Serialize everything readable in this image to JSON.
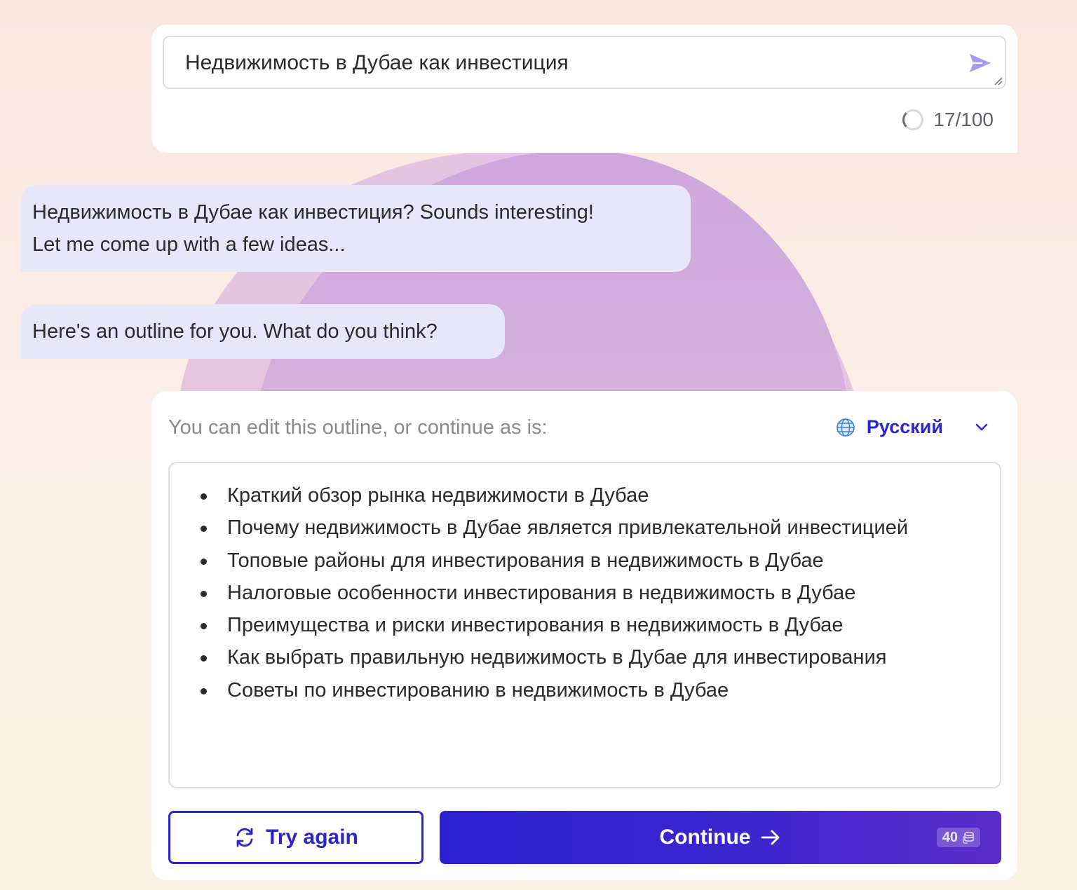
{
  "prompt": {
    "value": "Недвижимость в Дубае как инвестиция",
    "counter": "17/100"
  },
  "chat": {
    "bubble_1_line_1": "Недвижимость в Дубае как инвестиция? Sounds interesting!",
    "bubble_1_line_2": "Let me come up with a few ideas...",
    "bubble_2": "Here's an outline for you. What do you think?"
  },
  "outline": {
    "header": "You can edit this outline, or continue as is:",
    "language": "Русский",
    "items": [
      "Краткий обзор рынка недвижимости в Дубае",
      "Почему недвижимость в Дубае является привлекательной инвестицией",
      "Топовые районы для инвестирования в недвижимость в Дубае",
      "Налоговые особенности инвестирования в недвижимость в Дубае",
      "Преимущества и риски инвестирования в недвижимость в Дубае",
      "Как выбрать правильную недвижимость в Дубае для инвестирования",
      "Советы по инвестированию в недвижимость в Дубае"
    ]
  },
  "actions": {
    "try_again_label": "Try again",
    "continue_label": "Continue",
    "credit_cost": "40"
  },
  "colors": {
    "accent": "#2c25c9",
    "bubble": "#e8e6fb",
    "send_icon": "#a79af0"
  }
}
